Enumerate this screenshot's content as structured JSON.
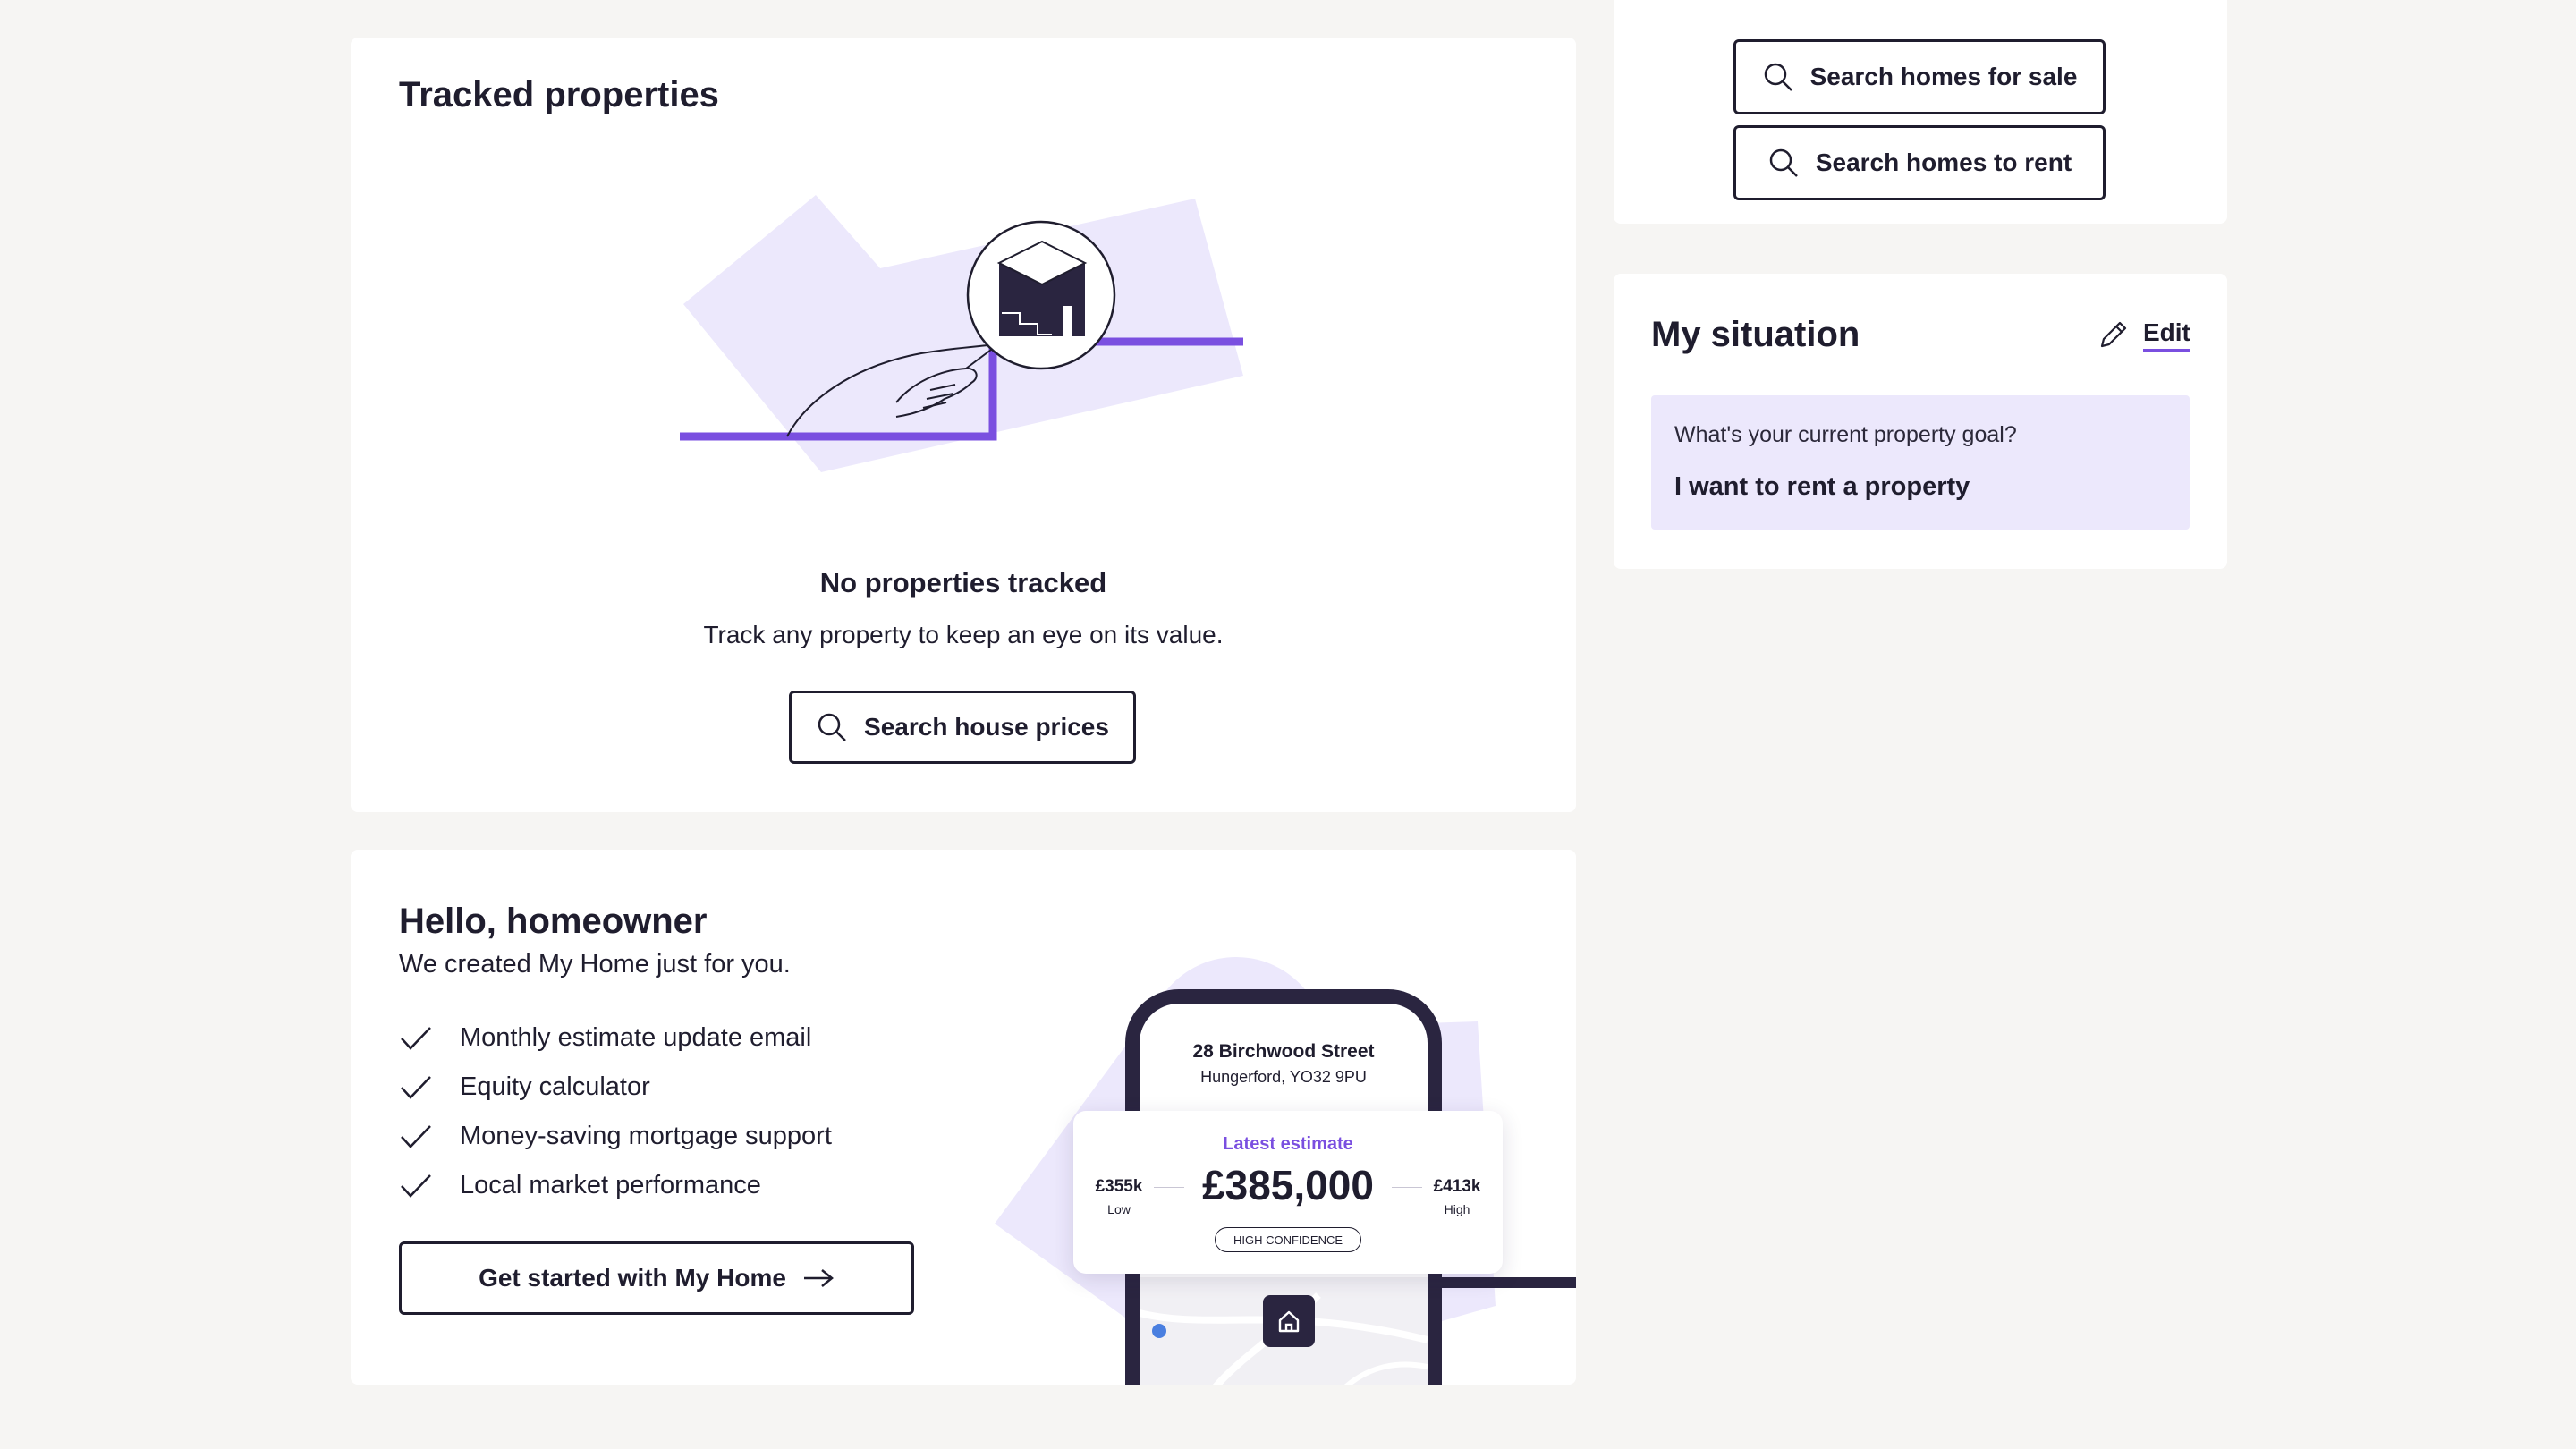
{
  "sidebar_search": {
    "sale_label": "Search homes for sale",
    "rent_label": "Search homes to rent"
  },
  "tracked": {
    "title": "Tracked properties",
    "empty_title": "No properties tracked",
    "empty_text": "Track any property to keep an eye on its value.",
    "search_label": "Search house prices"
  },
  "situation": {
    "title": "My situation",
    "edit_label": "Edit",
    "question": "What's your current property goal?",
    "answer": "I want to rent a property"
  },
  "hello": {
    "title": "Hello, homeowner",
    "subtitle": "We created My Home just for you.",
    "features": [
      "Monthly estimate update email",
      "Equity calculator",
      "Money-saving mortgage support",
      "Local market performance"
    ],
    "cta_label": "Get started with My Home"
  },
  "phone": {
    "address_line1": "28 Birchwood Street",
    "address_line2": "Hungerford, YO32 9PU",
    "estimate_label": "Latest estimate",
    "estimate_value": "£385,000",
    "low_value": "£355k",
    "low_label": "Low",
    "high_value": "£413k",
    "high_label": "High",
    "confidence": "HIGH CONFIDENCE"
  },
  "colors": {
    "accent": "#7a4fe0",
    "lavender": "#ece8fc",
    "navy": "#2a2540",
    "background": "#f6f5f3"
  },
  "icons": [
    "search-icon",
    "pencil-icon",
    "check-icon",
    "arrow-right-icon",
    "home-icon"
  ]
}
